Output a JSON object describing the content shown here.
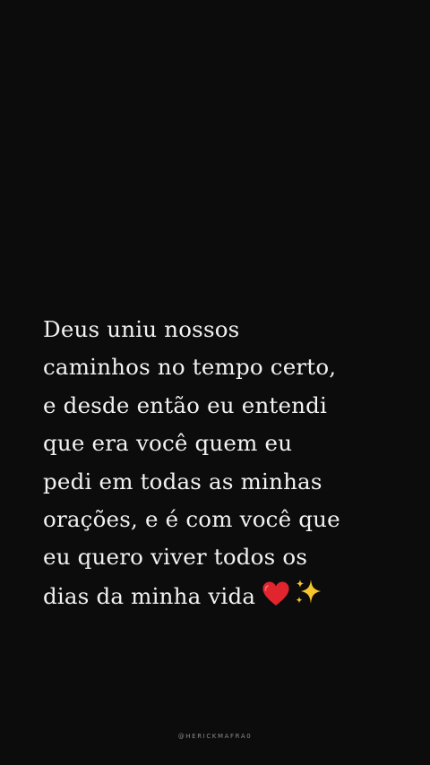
{
  "quote": {
    "lines": [
      "Deus uniu nossos",
      "caminhos no tempo certo,",
      "e desde então eu entendi",
      "que era você quem eu",
      "pedi em todas as minhas",
      "orações, e é com você que",
      "eu quero viver todos os",
      "dias da minha vida"
    ],
    "trailing_icons": [
      "red-heart-icon",
      "sparkles-icon"
    ]
  },
  "footer": {
    "handle": "@HERICKMAFRA0"
  },
  "colors": {
    "background": "#0c0c0d",
    "text": "#f2f2f2",
    "handle": "#8a8a8a",
    "heart": "#e0252f",
    "sparkles": "#f7c52b"
  }
}
